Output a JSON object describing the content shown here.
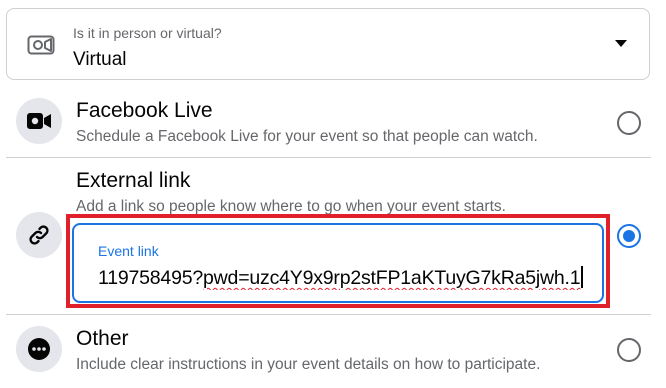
{
  "location_select": {
    "label": "Is it in person or virtual?",
    "value": "Virtual",
    "icon": "video-camera-icon"
  },
  "options": [
    {
      "title": "Facebook Live",
      "description": "Schedule a Facebook Live for your event so that people can watch.",
      "icon": "video-camera-icon",
      "selected": false
    },
    {
      "title": "External link",
      "description": "Add a link so people know where to go when your event starts.",
      "icon": "link-icon",
      "selected": true,
      "input": {
        "label": "Event link",
        "value_prefix": "119758495?",
        "value_spellchecked": "pwd=uzc4Y9x9rp2stFP1aKTuyG7kRa5jwh.1"
      }
    },
    {
      "title": "Other",
      "description": "Include clear instructions in your event details on how to participate.",
      "icon": "more-dots-icon",
      "selected": false
    }
  ],
  "colors": {
    "accent": "#1b74e4",
    "highlight": "#e0202b",
    "secondary_text": "#65676b",
    "icon_bg": "#e4e6eb"
  }
}
